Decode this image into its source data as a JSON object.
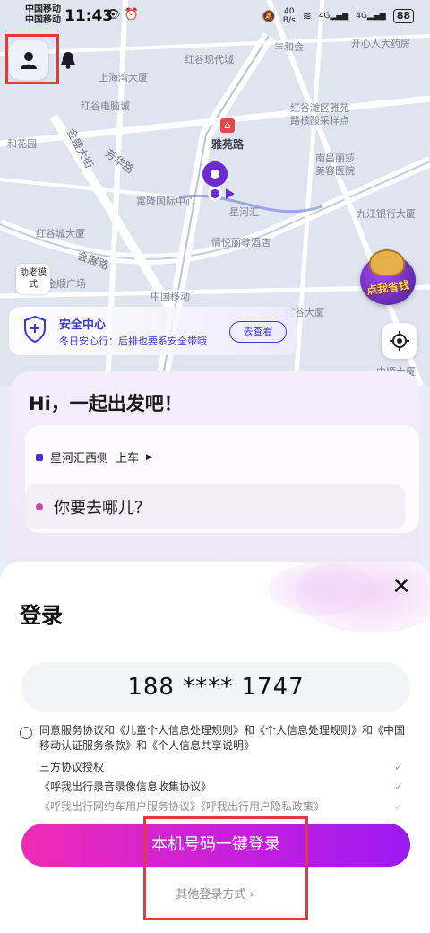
{
  "status_bar": {
    "carrier_1": "中国移动",
    "carrier_2": "中国移动",
    "time": "11:43",
    "net_speed_value": "40",
    "net_speed_unit": "B/s",
    "signal_1": "4G",
    "signal_2": "4G",
    "battery": "88"
  },
  "map": {
    "labels": {
      "fenghe": "丰和会",
      "kaixin": "开心人大药房",
      "shanghai_bay": "上海湾大厦",
      "honggu_modern": "红谷现代城",
      "honggu_digital": "红谷电脑城",
      "hongguwan_community": "红谷滩区雅苑",
      "nucleic": "路核酸采样点",
      "hualin": "和花园",
      "jinsheng": "金盛大街",
      "fangcheng": "芳华路",
      "metro": "雅苑路",
      "fulong": "富隆国际中心",
      "xinghe": "星河汇",
      "nanchang": "南昌丽莎",
      "meirong": "美容医院",
      "jiujiang": "九江银行大厦",
      "honggu_tower": "红谷城大厦",
      "huizhan": "会展路",
      "jingyue": "情悦丽尊酒店",
      "jinxia": "金顺广场",
      "cmcc": "中国移动",
      "honggu_big": "红谷大厦",
      "zhongshun": "中顺大厦"
    },
    "assist_mode": "助老模式",
    "promo_text": "点我省钱"
  },
  "safety": {
    "title": "安全中心",
    "subtitle": "冬日安心行：后排也要系安全带哦",
    "button": "去查看"
  },
  "trip": {
    "greeting": "Hi，一起出发吧！",
    "pickup": "星河汇西侧",
    "pickup_suffix": "上车",
    "destination_placeholder": "你要去哪儿？"
  },
  "login": {
    "title": "登录",
    "close": "✕",
    "phone": "188 **** 1747",
    "agreement": "同意服务协议和《儿童个人信息处理规则》和《个人信息处理规则》和《中国移动认证服务条款》和《个人信息共享说明》",
    "third_party_title": "三方协议授权",
    "third_party_1": "《呼我出行录音录像信息收集协议》",
    "third_party_2": "《呼我出行网约车用户服务协议》《呼我出行用户隐私政策》",
    "one_click_button": "本机号码一键登录",
    "other_methods": "其他登录方式 ›"
  },
  "colors": {
    "accent": "#6a2bd0",
    "gradient_start": "#ef2bb5",
    "gradient_end": "#9a1af0",
    "highlight_box": "#e03a3a"
  }
}
